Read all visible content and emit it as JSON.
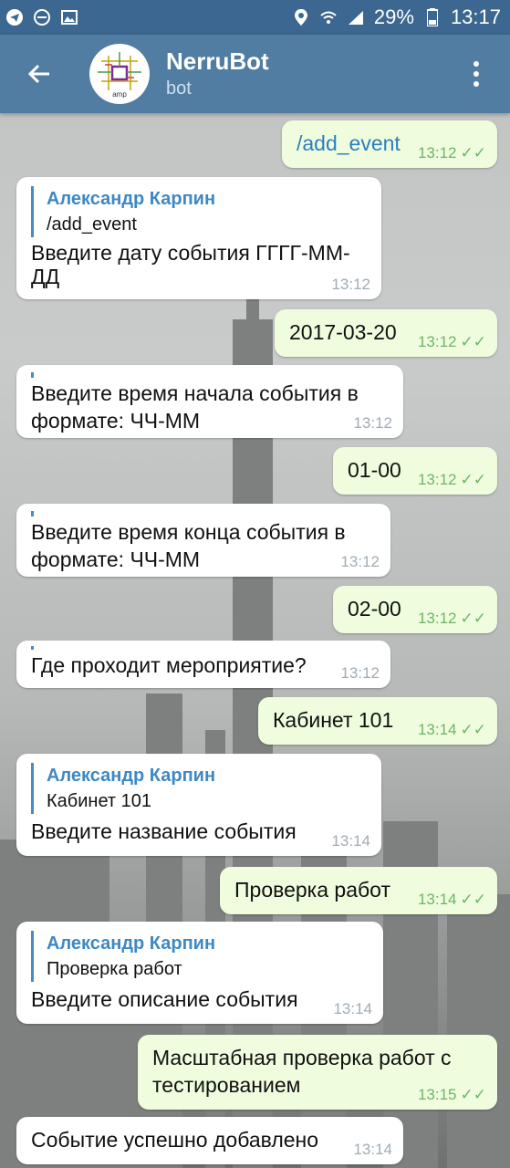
{
  "statusbar": {
    "battery_percent": "29%",
    "time": "13:17"
  },
  "chat": {
    "title": "NerruBot",
    "subtitle": "bot",
    "avatar_text": "amp"
  },
  "messages": [
    {
      "dir": "out",
      "text": "/add_event",
      "time": "13:12"
    },
    {
      "dir": "in",
      "reply_name": "Александр Карпин",
      "reply_text": "/add_event",
      "text": "Введите дату события ГГГГ-ММ-\nДД",
      "time": "13:12"
    },
    {
      "dir": "out",
      "text": "2017-03-20",
      "time": "13:12"
    },
    {
      "dir": "in",
      "text": "Введите время начала события в\nформате: ЧЧ-ММ",
      "time": "13:12"
    },
    {
      "dir": "out",
      "text": "01-00",
      "time": "13:12"
    },
    {
      "dir": "in",
      "text": "Введите время конца события в\nформате: ЧЧ-ММ",
      "time": "13:12"
    },
    {
      "dir": "out",
      "text": "02-00",
      "time": "13:12"
    },
    {
      "dir": "in",
      "text": "Где проходит мероприятие?",
      "time": "13:12"
    },
    {
      "dir": "out",
      "text": "Кабинет 101",
      "time": "13:14"
    },
    {
      "dir": "in",
      "reply_name": "Александр Карпин",
      "reply_text": "Кабинет 101",
      "text": "Введите название события",
      "time": "13:14"
    },
    {
      "dir": "out",
      "text": "Проверка работ",
      "time": "13:14"
    },
    {
      "dir": "in",
      "reply_name": "Александр Карпин",
      "reply_text": "Проверка работ",
      "text": "Введите описание события",
      "time": "13:14"
    },
    {
      "dir": "out",
      "text": "Масштабная проверка работ с\nтестированием",
      "time": "13:15"
    },
    {
      "dir": "in",
      "text": "Событие успешно добавлено",
      "time": "13:14"
    }
  ],
  "colors": {
    "appbar": "#517da2",
    "statusbar": "#3b6790",
    "outgoing_bubble": "#effdde",
    "incoming_bubble": "#ffffff",
    "check_color": "#6db566"
  }
}
